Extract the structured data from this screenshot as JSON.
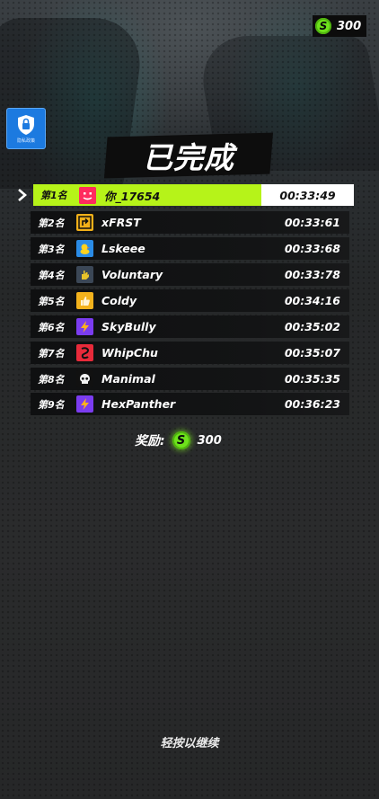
{
  "header": {
    "coins": "300"
  },
  "sidebar": {
    "lock_label": "隐私政策"
  },
  "results": {
    "title": "已完成",
    "rows": [
      {
        "rank": "第1名",
        "name": "你_17654",
        "time": "00:33:49",
        "avatar": "red-face-icon",
        "color": "#ff2b5e"
      },
      {
        "rank": "第2名",
        "name": "xFRST",
        "time": "00:33:61",
        "avatar": "arrow-sign-icon",
        "color": "#f2b019"
      },
      {
        "rank": "第3名",
        "name": "Lskeee",
        "time": "00:33:68",
        "avatar": "duck-icon",
        "color": "#2a8be6"
      },
      {
        "rank": "第4名",
        "name": "Voluntary",
        "time": "00:33:78",
        "avatar": "hand-gesture-icon",
        "color": "#e8c32a"
      },
      {
        "rank": "第5名",
        "name": "Coldy",
        "time": "00:34:16",
        "avatar": "thumbs-up-icon",
        "color": "#f3b21c"
      },
      {
        "rank": "第6名",
        "name": "SkyBully",
        "time": "00:35:02",
        "avatar": "lightning-icon",
        "color": "#7b3cf0"
      },
      {
        "rank": "第7名",
        "name": "WhipChu",
        "time": "00:35:07",
        "avatar": "dragon-icon",
        "color": "#e82a3a"
      },
      {
        "rank": "第8名",
        "name": "Manimal",
        "time": "00:35:35",
        "avatar": "skull-icon",
        "color": "#111111"
      },
      {
        "rank": "第9名",
        "name": "HexPanther",
        "time": "00:36:23",
        "avatar": "lightning-icon",
        "color": "#7b3cf0"
      }
    ]
  },
  "reward": {
    "label": "奖励:",
    "amount": "300"
  },
  "footer": {
    "continue_text": "轻按以继续"
  },
  "colors": {
    "highlight": "#b6f319",
    "coin": "#6ee21c",
    "lock_button": "#1c7ae0"
  }
}
